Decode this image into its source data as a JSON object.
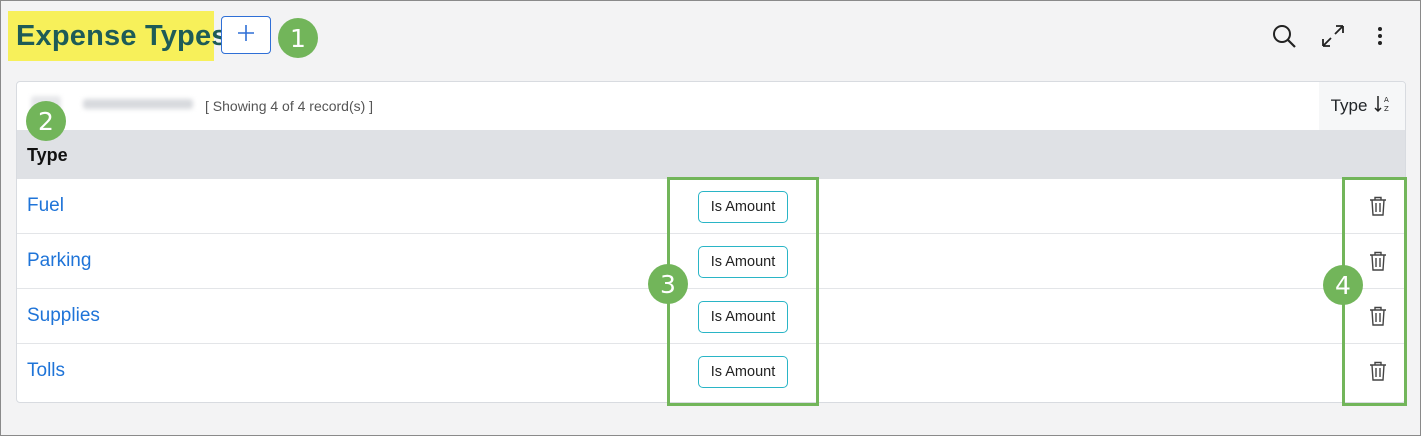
{
  "header": {
    "title": "Expense Types",
    "add_icon": "plus-icon",
    "toolbar_icons": [
      "search-icon",
      "expand-icon",
      "more-vertical-icon"
    ]
  },
  "callouts": [
    "1",
    "2",
    "3",
    "4"
  ],
  "table": {
    "record_count": "[ Showing 4 of 4 record(s) ]",
    "sort_label": "Type",
    "sort_icon": "sort-alpha-down-icon",
    "column_header": "Type",
    "rows": [
      {
        "type": "Fuel",
        "badge": "Is Amount"
      },
      {
        "type": "Parking",
        "badge": "Is Amount"
      },
      {
        "type": "Supplies",
        "badge": "Is Amount"
      },
      {
        "type": "Tolls",
        "badge": "Is Amount"
      }
    ],
    "delete_icon": "trash-icon"
  },
  "colors": {
    "title_highlight": "#f7f05a",
    "title_text": "#1e5c57",
    "accent_blue": "#2f6fd6",
    "link_blue": "#1f74d8",
    "badge_border": "#2ab5c6",
    "callout_green": "#72b55a"
  }
}
